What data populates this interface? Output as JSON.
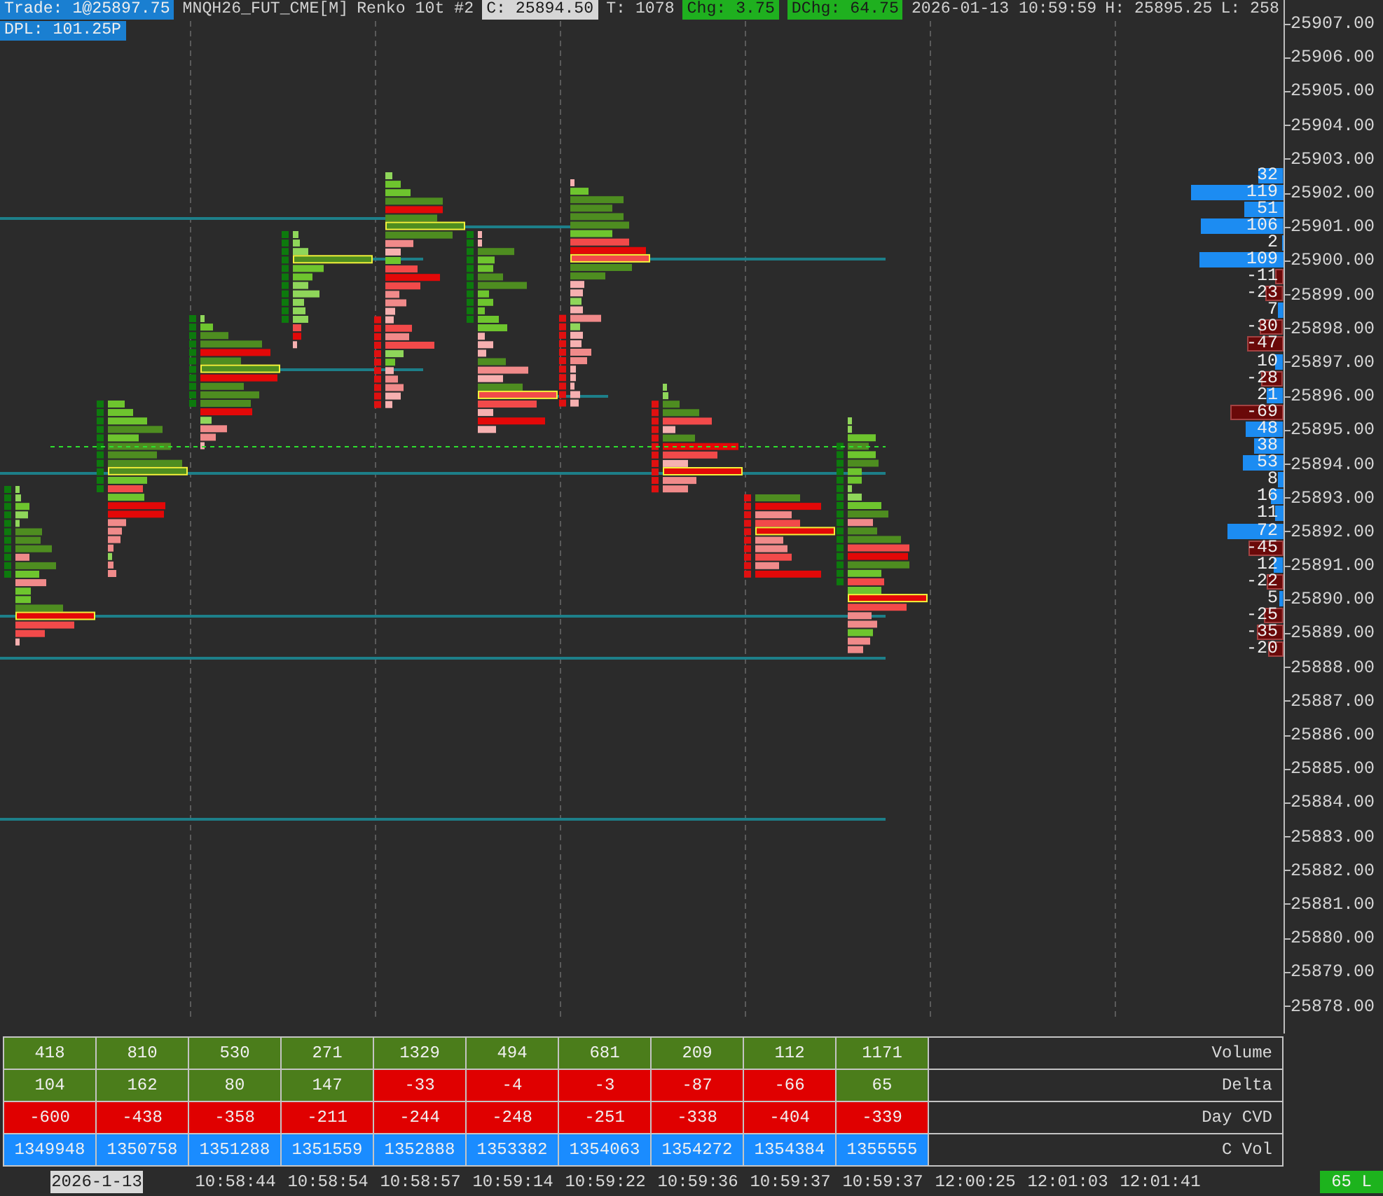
{
  "header": {
    "line_1": [
      {
        "text": "Trade: 1@25897.75",
        "kind": "blue"
      },
      {
        "text": "MNQH26_FUT_CME[M]",
        "kind": "plain"
      },
      {
        "text": "Renko 10t #2",
        "kind": "plain"
      },
      {
        "text": "C: 25894.50",
        "kind": "light"
      },
      {
        "text": "T: 1078",
        "kind": "plain"
      },
      {
        "text": "Chg: 3.75",
        "kind": "green"
      },
      {
        "text": "DChg: 64.75",
        "kind": "green"
      },
      {
        "text": "2026-01-13 10:59:59",
        "kind": "plain"
      },
      {
        "text": "H: 25895.25",
        "kind": "plain"
      },
      {
        "text": "L: 258",
        "kind": "plain"
      }
    ],
    "line_2": [
      {
        "text": "DPL: 101.25P",
        "kind": "blue"
      }
    ]
  },
  "price_axis": {
    "labels": [
      "25907.00",
      "25906.00",
      "25905.00",
      "25904.00",
      "25903.00",
      "25902.00",
      "25901.00",
      "25900.00",
      "25899.00",
      "25898.00",
      "25897.00",
      "25896.00",
      "25895.00",
      "25894.00",
      "25893.00",
      "25892.00",
      "25891.00",
      "25890.00",
      "25889.00",
      "25888.00",
      "25887.00",
      "25886.00",
      "25885.00",
      "25884.00",
      "25883.00",
      "25882.00",
      "25881.00",
      "25880.00",
      "25879.00",
      "25878.00"
    ]
  },
  "ladder": {
    "rows": [
      {
        "value": "32",
        "kind": "buy"
      },
      {
        "value": "119",
        "kind": "buy"
      },
      {
        "value": "51",
        "kind": "buy"
      },
      {
        "value": "106",
        "kind": "buy"
      },
      {
        "value": "2",
        "kind": "buy"
      },
      {
        "value": "109",
        "kind": "buy"
      },
      {
        "value": "-11",
        "kind": "sell"
      },
      {
        "value": "-23",
        "kind": "sell"
      },
      {
        "value": "7",
        "kind": "buy"
      },
      {
        "value": "-30",
        "kind": "sell"
      },
      {
        "value": "-47",
        "kind": "sell"
      },
      {
        "value": "10",
        "kind": "buy"
      },
      {
        "value": "-28",
        "kind": "sell"
      },
      {
        "value": "21",
        "kind": "buy"
      },
      {
        "value": "-69",
        "kind": "sell"
      },
      {
        "value": "48",
        "kind": "buy"
      },
      {
        "value": "38",
        "kind": "buy"
      },
      {
        "value": "53",
        "kind": "buy"
      },
      {
        "value": "8",
        "kind": "buy"
      },
      {
        "value": "16",
        "kind": "buy"
      },
      {
        "value": "11",
        "kind": "buy"
      },
      {
        "value": "72",
        "kind": "buy"
      },
      {
        "value": "-45",
        "kind": "sell"
      },
      {
        "value": "12",
        "kind": "buy"
      },
      {
        "value": "-22",
        "kind": "sell"
      },
      {
        "value": "5",
        "kind": "buy"
      },
      {
        "value": "-25",
        "kind": "sell"
      },
      {
        "value": "-35",
        "kind": "sell"
      },
      {
        "value": "-20",
        "kind": "sell"
      }
    ]
  },
  "table": {
    "rows": [
      {
        "label": "Volume",
        "cells": [
          {
            "text": "418",
            "color": "#4b7d1b"
          },
          {
            "text": "810",
            "color": "#4b7d1b"
          },
          {
            "text": "530",
            "color": "#4b7d1b"
          },
          {
            "text": "271",
            "color": "#4b7d1b"
          },
          {
            "text": "1329",
            "color": "#4b7d1b"
          },
          {
            "text": "494",
            "color": "#4b7d1b"
          },
          {
            "text": "681",
            "color": "#4b7d1b"
          },
          {
            "text": "209",
            "color": "#4b7d1b"
          },
          {
            "text": "112",
            "color": "#4b7d1b"
          },
          {
            "text": "1171",
            "color": "#4b7d1b"
          }
        ]
      },
      {
        "label": "Delta",
        "cells": [
          {
            "text": "104",
            "color": "#4b7d1b"
          },
          {
            "text": "162",
            "color": "#4b7d1b"
          },
          {
            "text": "80",
            "color": "#4b7d1b"
          },
          {
            "text": "147",
            "color": "#4b7d1b"
          },
          {
            "text": "-33",
            "color": "#e00000"
          },
          {
            "text": "-4",
            "color": "#e00000"
          },
          {
            "text": "-3",
            "color": "#e00000"
          },
          {
            "text": "-87",
            "color": "#e00000"
          },
          {
            "text": "-66",
            "color": "#e00000"
          },
          {
            "text": "65",
            "color": "#4b7d1b"
          }
        ]
      },
      {
        "label": "Day CVD",
        "cells": [
          {
            "text": "-600",
            "color": "#e00000"
          },
          {
            "text": "-438",
            "color": "#e00000"
          },
          {
            "text": "-358",
            "color": "#e00000"
          },
          {
            "text": "-211",
            "color": "#e00000"
          },
          {
            "text": "-244",
            "color": "#e00000"
          },
          {
            "text": "-248",
            "color": "#e00000"
          },
          {
            "text": "-251",
            "color": "#e00000"
          },
          {
            "text": "-338",
            "color": "#e00000"
          },
          {
            "text": "-404",
            "color": "#e00000"
          },
          {
            "text": "-339",
            "color": "#e00000"
          }
        ]
      },
      {
        "label": "C Vol",
        "cells": [
          {
            "text": "1349948",
            "color": "#1a8cff"
          },
          {
            "text": "1350758",
            "color": "#1a8cff"
          },
          {
            "text": "1351288",
            "color": "#1a8cff"
          },
          {
            "text": "1351559",
            "color": "#1a8cff"
          },
          {
            "text": "1352888",
            "color": "#1a8cff"
          },
          {
            "text": "1353382",
            "color": "#1a8cff"
          },
          {
            "text": "1354063",
            "color": "#1a8cff"
          },
          {
            "text": "1354272",
            "color": "#1a8cff"
          },
          {
            "text": "1354384",
            "color": "#1a8cff"
          },
          {
            "text": "1355555",
            "color": "#1a8cff"
          }
        ]
      }
    ]
  },
  "time_axis": {
    "date": "2026-1-13",
    "times": [
      "10:58:44",
      "10:58:54",
      "10:58:57",
      "10:59:14",
      "10:59:22",
      "10:59:36",
      "10:59:37",
      "10:59:37",
      "12:00:25",
      "12:01:03",
      "12:01:41"
    ]
  },
  "status_badge": "65 L"
}
